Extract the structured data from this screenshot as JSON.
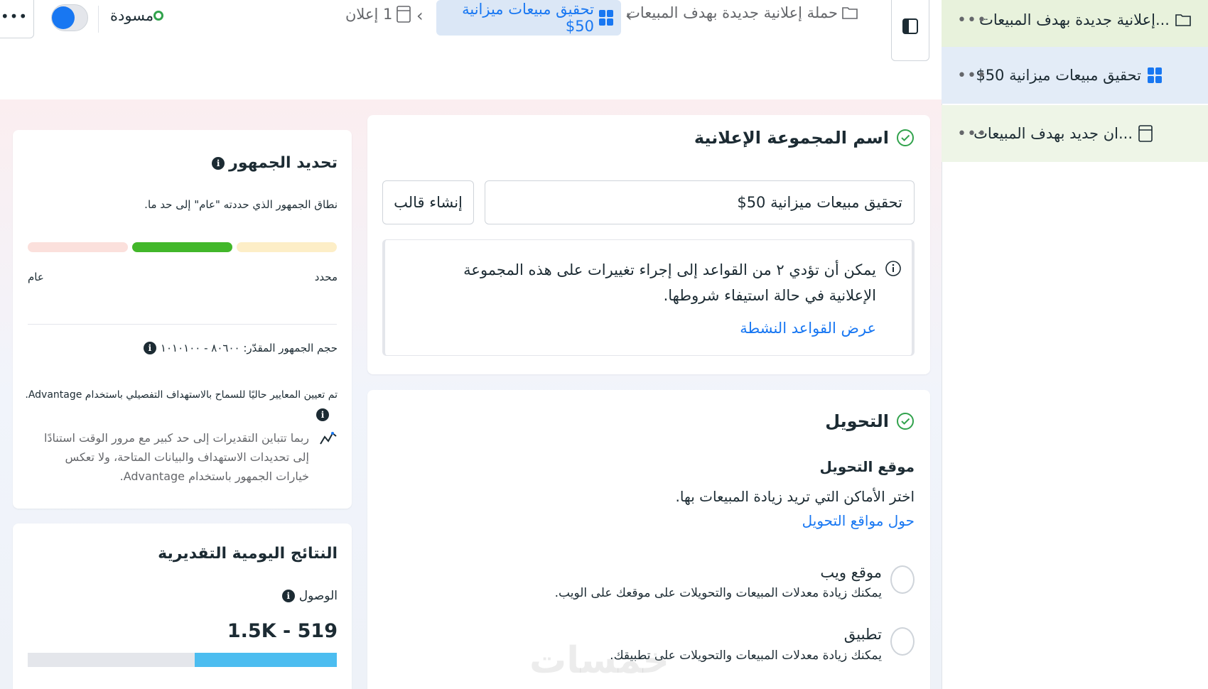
{
  "sidebar": {
    "items": [
      {
        "label": "...إعلانية جديدة بهدف المبيعات",
        "more": "•••"
      },
      {
        "label": "تحقيق مبيعات ميزانية 50$",
        "more": "•••"
      },
      {
        "label": "...ان جديد بهدف المبيعات",
        "more": "•••"
      }
    ]
  },
  "topbar": {
    "campaign": "حملة إعلانية جديدة بهدف المبيعات",
    "adset": "تحقيق مبيعات ميزانية 50$",
    "ads": "1 إعلان",
    "status": "مسودة",
    "more": "•••",
    "separator": "›"
  },
  "adset_name": {
    "title": "اسم المجموعة الإعلانية",
    "input_value": "تحقيق مبيعات ميزانية 50$",
    "template_button": "إنشاء قالب",
    "rules_text": "يمكن أن تؤدي ٢ من القواعد إلى إجراء تغييرات على هذه المجموعة الإعلانية في حالة استيفاء شروطها.",
    "rules_link": "عرض القواعد النشطة"
  },
  "conversion": {
    "title": "التحويل",
    "location_label": "موقع التحويل",
    "description": "اختر الأماكن التي تريد زيادة المبيعات بها.",
    "link": "حول مواقع التحويل",
    "options": [
      {
        "title": "موقع ويب",
        "desc": "يمكنك زيادة معدلات المبيعات والتحويلات على موقعك على الويب."
      },
      {
        "title": "تطبيق",
        "desc": "يمكنك زيادة معدلات المبيعات والتحويلات على تطبيقك."
      }
    ]
  },
  "audience": {
    "title": "تحديد الجمهور",
    "description": "نطاق الجمهور الذي حددته \"عام\" إلى حد ما.",
    "label_specific": "محدد",
    "label_broad": "عام",
    "size": "حجم الجمهور المقدّر: ٨٠٦٠٠ - ١٠١٠١٠٠",
    "advantage_note": "تم تعيين المعايير حاليًا للسماح بالاستهداف التفصيلي باستخدام Advantage.",
    "variance_note": "ربما تتباين التقديرات إلى حد كبير مع مرور الوقت استنادًا إلى تحديدات الاستهداف والبيانات المتاحة، ولا تعكس خيارات الجمهور باستخدام Advantage."
  },
  "daily_results": {
    "title": "النتائج اليومية التقديرية",
    "reach_label": "الوصول",
    "reach_value": "1.5K - 519",
    "reach_fill": 0.46
  },
  "watermark": "خمسات",
  "colors": {
    "accent": "#1877f2",
    "draft": "#31a24c",
    "meter_active": "#42b72a",
    "reach_bar": "#4cbdf0"
  }
}
